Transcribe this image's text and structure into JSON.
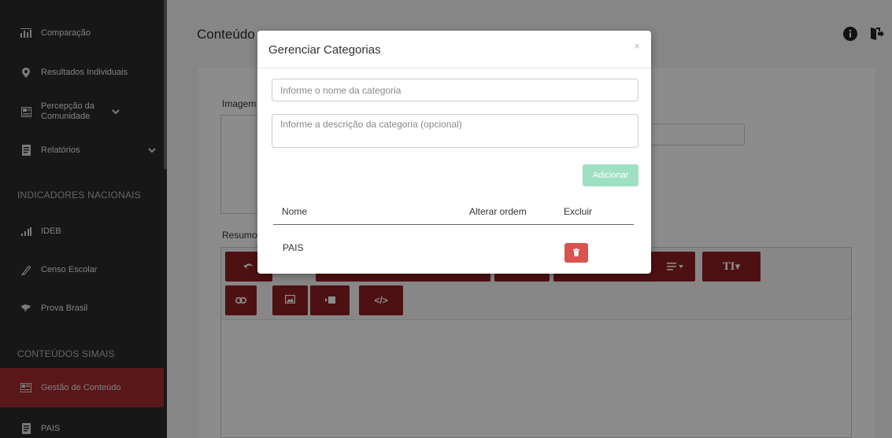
{
  "sidebar": {
    "items": [
      {
        "label": "Comparação",
        "icon": "bar-chart-icon"
      },
      {
        "label": "Resultados Individuais",
        "icon": "location-pin-icon"
      },
      {
        "label": "Percepção da Comunidade",
        "icon": "newspaper-icon"
      },
      {
        "label": "Relatórios",
        "icon": "report-icon"
      }
    ],
    "section_national": "INDICADORES NACIONAIS",
    "national_items": [
      {
        "label": "IDEB",
        "icon": "bar-chart-icon"
      },
      {
        "label": "Censo Escolar",
        "icon": "pencil-icon"
      },
      {
        "label": "Prova Brasil",
        "icon": "brazil-map-icon"
      }
    ],
    "section_content": "CONTEÚDOS SIMAIS",
    "content_items": [
      {
        "label": "Gestão de Conteúdo",
        "icon": "newspaper-icon",
        "active": true
      },
      {
        "label": "PAIS",
        "icon": "report-icon"
      }
    ]
  },
  "header": {
    "title": "Conteúdo"
  },
  "form": {
    "image_label": "Imagem",
    "summary_label": "Resumo"
  },
  "modal": {
    "title": "Gerenciar Categorias",
    "close": "×",
    "name_placeholder": "Informe o nome da categoria",
    "desc_placeholder": "Informe a descrição da categoria (opcional)",
    "add_label": "Adicionar",
    "columns": [
      "Nome",
      "Alterar ordem",
      "Excluir"
    ],
    "rows": [
      {
        "name": "PAIS"
      }
    ]
  },
  "colors": {
    "sidebar_bg": "#2b2b2b",
    "active": "#a52a2f",
    "toolbar_btn": "#8f1f23",
    "add_btn": "#9fe0c3",
    "delete_btn": "#d9534f"
  }
}
